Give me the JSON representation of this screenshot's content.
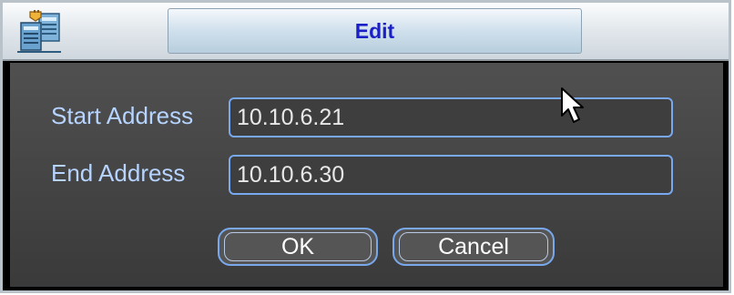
{
  "window": {
    "title": "Edit"
  },
  "form": {
    "start_label": "Start Address",
    "start_value": "10.10.6.21",
    "end_label": "End Address",
    "end_value": "10.10.6.30"
  },
  "buttons": {
    "ok": "OK",
    "cancel": "Cancel"
  },
  "icons": {
    "title_icon": "network-computers-icon",
    "cursor": "mouse-pointer-icon"
  },
  "colors": {
    "title_text": "#1a1fc6",
    "label_text": "#b6d4ff",
    "field_border": "#78a8f0",
    "panel_bg": "#3a3a3a"
  }
}
